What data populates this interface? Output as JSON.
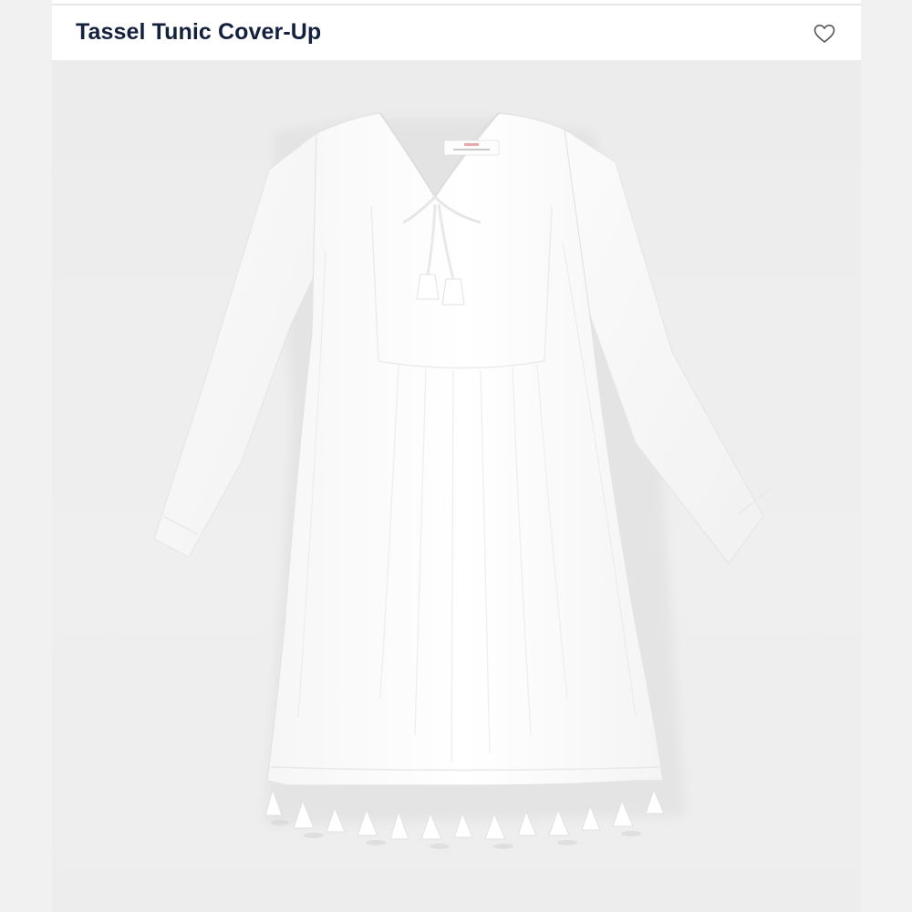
{
  "product": {
    "title": "Tassel Tunic Cover-Up",
    "wishlist_icon": "heart-outline-icon"
  },
  "image": {
    "subject": "white-tunic-photo",
    "background_color": "#eeeeee",
    "garment_color": "#ffffff"
  },
  "colors": {
    "title_text": "#14213d",
    "icon_stroke": "#555555",
    "card_background": "#ffffff",
    "page_background": "#f2f2f2"
  }
}
